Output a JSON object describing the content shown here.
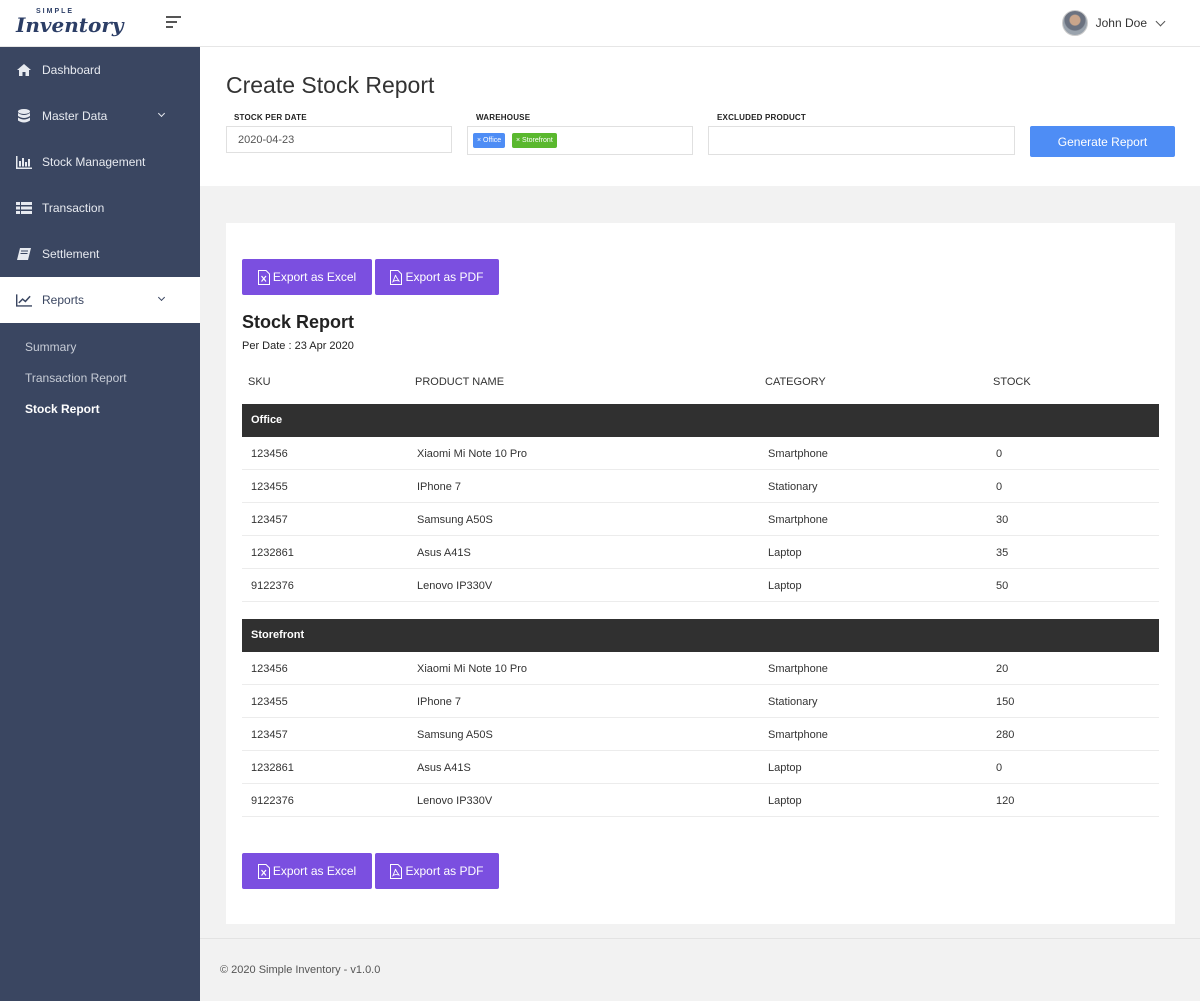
{
  "brand": {
    "small": "SIMPLE",
    "name": "Inventory"
  },
  "user": {
    "name": "John Doe"
  },
  "sidebar": {
    "items": [
      {
        "label": "Dashboard",
        "icon": "home-icon"
      },
      {
        "label": "Master Data",
        "icon": "database-icon",
        "expandable": true
      },
      {
        "label": "Stock Management",
        "icon": "bar-chart-icon"
      },
      {
        "label": "Transaction",
        "icon": "list-icon"
      },
      {
        "label": "Settlement",
        "icon": "book-icon"
      },
      {
        "label": "Reports",
        "icon": "line-chart-icon",
        "expandable": true,
        "active": true
      }
    ],
    "sub_items": [
      {
        "label": "Summary"
      },
      {
        "label": "Transaction Report"
      },
      {
        "label": "Stock Report",
        "current": true
      }
    ]
  },
  "header": {
    "title": "Create Stock Report",
    "stock_per_date_label": "STOCK PER DATE",
    "stock_per_date_value": "2020-04-23",
    "warehouse_label": "WAREHOUSE",
    "warehouse_tags": [
      {
        "label": "× Office",
        "color": "#4e8df5"
      },
      {
        "label": "× Storefront",
        "color": "#5ab82e"
      }
    ],
    "excluded_label": "EXCLUDED PRODUCT",
    "excluded_value": "",
    "generate_label": "Generate Report"
  },
  "report": {
    "export_excel": "Export as Excel",
    "export_pdf": "Export as PDF",
    "title": "Stock Report",
    "date": "Per Date : 23 Apr 2020",
    "columns": [
      "SKU",
      "PRODUCT NAME",
      "CATEGORY",
      "STOCK"
    ],
    "groups": [
      {
        "name": "Office",
        "rows": [
          {
            "sku": "123456",
            "product": "Xiaomi Mi Note 10 Pro",
            "category": "Smartphone",
            "stock": "0"
          },
          {
            "sku": "123455",
            "product": "IPhone 7",
            "category": "Stationary",
            "stock": "0"
          },
          {
            "sku": "123457",
            "product": "Samsung A50S",
            "category": "Smartphone",
            "stock": "30"
          },
          {
            "sku": "1232861",
            "product": "Asus A41S",
            "category": "Laptop",
            "stock": "35"
          },
          {
            "sku": "9122376",
            "product": "Lenovo IP330V",
            "category": "Laptop",
            "stock": "50"
          }
        ]
      },
      {
        "name": "Storefront",
        "rows": [
          {
            "sku": "123456",
            "product": "Xiaomi Mi Note 10 Pro",
            "category": "Smartphone",
            "stock": "20"
          },
          {
            "sku": "123455",
            "product": "IPhone 7",
            "category": "Stationary",
            "stock": "150"
          },
          {
            "sku": "123457",
            "product": "Samsung A50S",
            "category": "Smartphone",
            "stock": "280"
          },
          {
            "sku": "1232861",
            "product": "Asus A41S",
            "category": "Laptop",
            "stock": "0"
          },
          {
            "sku": "9122376",
            "product": "Lenovo IP330V",
            "category": "Laptop",
            "stock": "120"
          }
        ]
      }
    ]
  },
  "footer": {
    "text": "© 2020 Simple Inventory - v1.0.0"
  }
}
